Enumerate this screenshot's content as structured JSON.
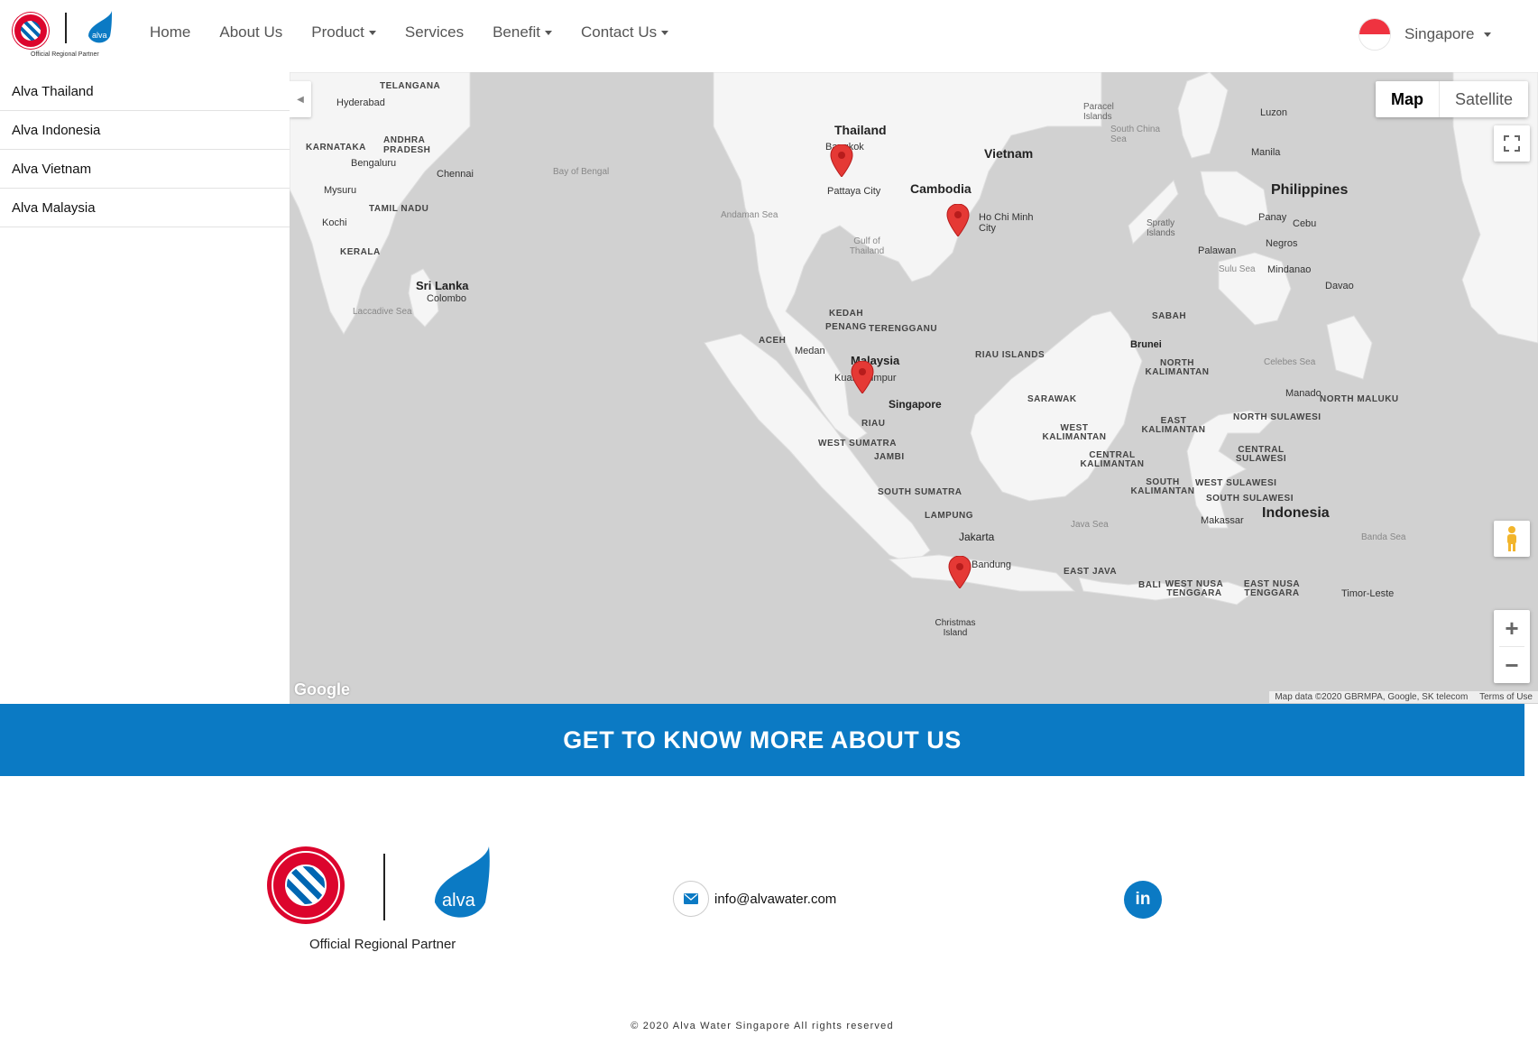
{
  "header": {
    "logo_partner_text": "Official Regional Partner",
    "nav": [
      {
        "label": "Home",
        "dropdown": false
      },
      {
        "label": "About Us",
        "dropdown": false
      },
      {
        "label": "Product",
        "dropdown": true
      },
      {
        "label": "Services",
        "dropdown": false
      },
      {
        "label": "Benefit",
        "dropdown": true
      },
      {
        "label": "Contact Us",
        "dropdown": true
      }
    ],
    "country": {
      "label": "Singapore",
      "flag": "singapore-flag"
    }
  },
  "sidebar": {
    "items": [
      {
        "label": "Alva Thailand"
      },
      {
        "label": "Alva Indonesia"
      },
      {
        "label": "Alva Vietnam"
      },
      {
        "label": "Alva Malaysia"
      }
    ]
  },
  "map": {
    "type_buttons": {
      "map": "Map",
      "satellite": "Satellite"
    },
    "google_logo": "Google",
    "attribution": "Map data ©2020 GBRMPA, Google, SK telecom",
    "terms": "Terms of Use",
    "labels": {
      "thailand": "Thailand",
      "bangkok": "Bangkok",
      "vietnam": "Vietnam",
      "cambodia": "Cambodia",
      "hochiminh": "Ho Chi Minh City",
      "philippines": "Philippines",
      "manila": "Manila",
      "luzon": "Luzon",
      "malaysia": "Malaysia",
      "kualalumpur": "Kuala Lumpur",
      "singapore": "Singapore",
      "srilanka": "Sri Lanka",
      "colombo": "Colombo",
      "hyderabad": "Hyderabad",
      "bengaluru": "Bengaluru",
      "chennai": "Chennai",
      "indonesia": "Indonesia",
      "jakarta": "Jakarta",
      "bandung": "Bandung",
      "medan": "Medan",
      "brunei": "Brunei",
      "davao": "Davao",
      "pattaya": "Pattaya City",
      "bay_of_bengal": "Bay of Bengal",
      "andaman_sea": "Andaman Sea",
      "south_china_sea": "South China Sea",
      "java_sea": "Java Sea",
      "celebes_sea": "Celebes Sea",
      "banda_sea": "Banda Sea",
      "sulu_sea": "Sulu Sea",
      "gulf_thailand": "Gulf of Thailand",
      "laccadive_sea": "Laccadive Sea",
      "telangana": "TELANGANA",
      "karnataka": "KARNATAKA",
      "andhra": "ANDHRA PRADESH",
      "tamil": "TAMIL NADU",
      "kerala": "KERALA",
      "kedah": "KEDAH",
      "penang": "PENANG",
      "terengganu": "TERENGGANU",
      "aceh": "ACEH",
      "riau": "RIAU",
      "riau_islands": "RIAU ISLANDS",
      "west_sumatra": "WEST SUMATRA",
      "jambi": "JAMBI",
      "south_sumatra": "SOUTH SUMATRA",
      "lampung": "LAMPUNG",
      "east_java": "EAST JAVA",
      "sabah": "SABAH",
      "sarawak": "SARAWAK",
      "north_kal": "NORTH KALIMANTAN",
      "east_kal": "EAST KALIMANTAN",
      "west_kal": "WEST KALIMANTAN",
      "central_kal": "CENTRAL KALIMANTAN",
      "south_kal": "SOUTH KALIMANTAN",
      "north_sulawesi": "NORTH SULAWESI",
      "central_sulawesi": "CENTRAL SULAWESI",
      "west_sulawesi": "WEST SULAWESI",
      "south_sulawesi": "SOUTH SULAWESI",
      "makassar": "Makassar",
      "bali": "BALI",
      "west_nusa": "WEST NUSA TENGGARA",
      "east_nusa": "EAST NUSA TENGGARA",
      "timor": "Timor-Leste",
      "christmas": "Christmas Island",
      "manado": "Manado",
      "north_maluku": "NORTH MALUKU",
      "cebu": "Cebu",
      "panay": "Panay",
      "negros": "Negros",
      "mindanao": "Mindanao",
      "palawan": "Palawan",
      "paracel": "Paracel Islands",
      "spratly": "Spratly Islands",
      "mysuru": "Mysuru",
      "kochi": "Kochi"
    }
  },
  "cta": {
    "label": "GET TO KNOW MORE ABOUT US"
  },
  "footer": {
    "partner_text": "Official Regional Partner",
    "email": "info@alvawater.com",
    "social": "in",
    "copyright": "© 2020 Alva Water Singapore All rights reserved"
  },
  "colors": {
    "brand_blue": "#0b7ac4",
    "bayern_red": "#dc052d",
    "map_water": "#d1d1d1",
    "map_land": "#f5f5f5",
    "pin": "#e53935"
  }
}
